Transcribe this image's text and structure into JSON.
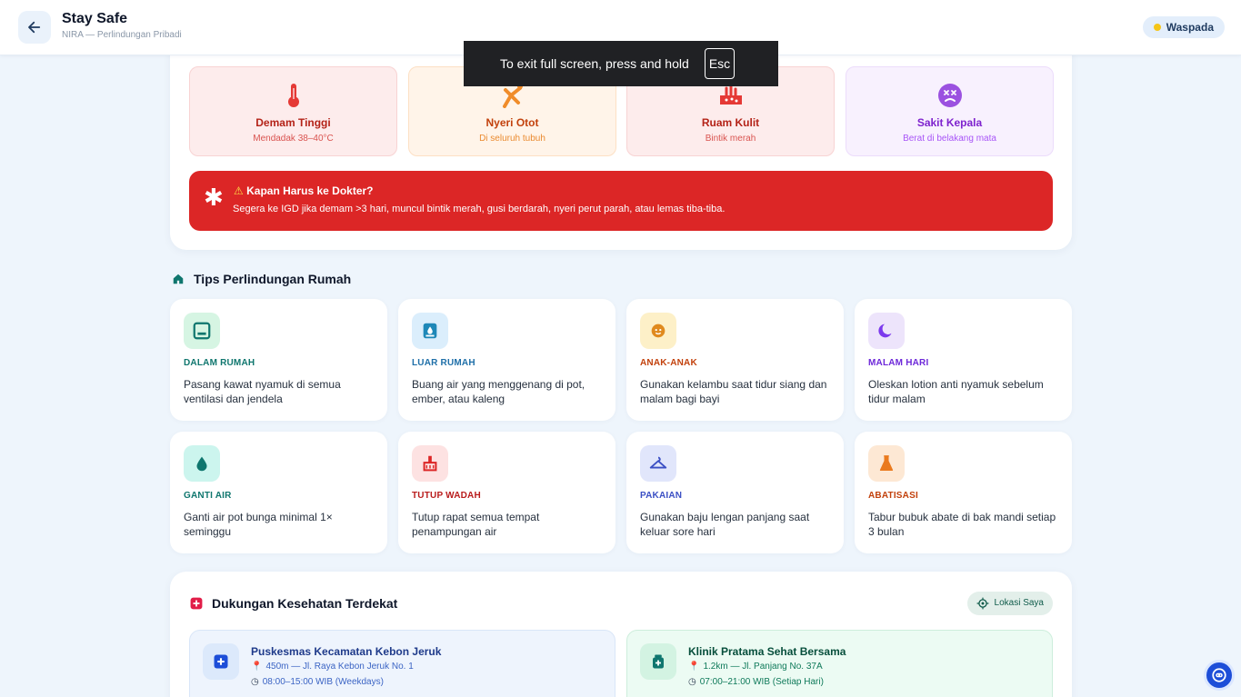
{
  "header": {
    "title": "Stay Safe",
    "subtitle": "NIRA — Perlindungan Pribadi",
    "status": "Waspada"
  },
  "symptoms": [
    {
      "title": "Demam Tinggi",
      "sub": "Mendadak 38–40°C",
      "icon": "thermometer-icon"
    },
    {
      "title": "Nyeri Otot",
      "sub": "Di seluruh tubuh",
      "icon": "muscle-pain-icon"
    },
    {
      "title": "Ruam Kulit",
      "sub": "Bintik merah",
      "icon": "skin-rash-icon"
    },
    {
      "title": "Sakit Kepala",
      "sub": "Berat di belakang mata",
      "icon": "dizzy-face-icon"
    }
  ],
  "alert": {
    "title": "Kapan Harus ke Dokter?",
    "body": "Segera ke IGD jika demam >3 hari, muncul bintik merah, gusi berdarah, nyeri perut parah, atau lemas tiba-tiba."
  },
  "tips": {
    "heading": "Tips Perlindungan Rumah",
    "items": [
      {
        "category": "DALAM RUMAH",
        "desc": "Pasang kawat nyamuk di semua ventilasi dan jendela",
        "icon": "window-icon"
      },
      {
        "category": "LUAR RUMAH",
        "desc": "Buang air yang menggenang di pot, ember, atau kaleng",
        "icon": "water-drain-icon"
      },
      {
        "category": "ANAK-ANAK",
        "desc": "Gunakan kelambu saat tidur siang dan malam bagi bayi",
        "icon": "child-face-icon"
      },
      {
        "category": "MALAM HARI",
        "desc": "Oleskan lotion anti nyamuk sebelum tidur malam",
        "icon": "moon-icon"
      },
      {
        "category": "GANTI AIR",
        "desc": "Ganti air pot bunga minimal 1× seminggu",
        "icon": "water-drop-icon"
      },
      {
        "category": "TUTUP WADAH",
        "desc": "Tutup rapat semua tempat penampungan air",
        "icon": "container-icon"
      },
      {
        "category": "PAKAIAN",
        "desc": "Gunakan baju lengan panjang saat keluar sore hari",
        "icon": "hanger-icon"
      },
      {
        "category": "ABATISASI",
        "desc": "Tabur bubuk abate di bak mandi setiap 3 bulan",
        "icon": "flask-icon"
      }
    ]
  },
  "support": {
    "title": "Dukungan Kesehatan Terdekat",
    "location_button": "Lokasi Saya",
    "facilities": [
      {
        "name": "Puskesmas Kecamatan Kebon Jeruk",
        "address": "450m — Jl. Raya Kebon Jeruk No. 1",
        "hours": "08:00–15:00 WIB (Weekdays)"
      },
      {
        "name": "Klinik Pratama Sehat Bersama",
        "address": "1.2km — Jl. Panjang No. 37A",
        "hours": "07:00–21:00 WIB (Setiap Hari)"
      }
    ]
  },
  "toast": {
    "text": "To exit full screen, press and hold",
    "key": "Esc"
  },
  "colors": {
    "accent": "#1d4ed8",
    "alert": "#dc2626",
    "status_dot": "#f5c518"
  }
}
